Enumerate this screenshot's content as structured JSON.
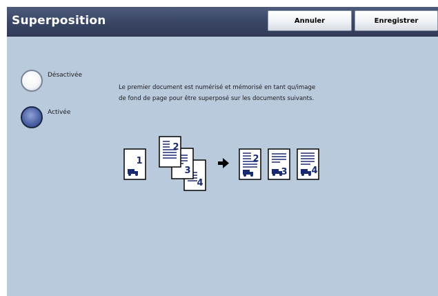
{
  "header": {
    "title": "Superposition",
    "cancel_label": "Annuler",
    "save_label": "Enregistrer"
  },
  "options": [
    {
      "label": "Désactivée",
      "selected": false
    },
    {
      "label": "Activée",
      "selected": true
    }
  ],
  "description": "Le premier document est numérisé et mémorisé en tant qu/image de fond de page pour être superposé sur les documents suivants.",
  "diagram": {
    "source_pages": [
      "1",
      "2",
      "3",
      "4"
    ],
    "result_pages": [
      "2",
      "3",
      "4"
    ]
  },
  "colors": {
    "header": "#3a4765",
    "panel": "#b9cadd",
    "radio_selected": "#4f63a8"
  }
}
